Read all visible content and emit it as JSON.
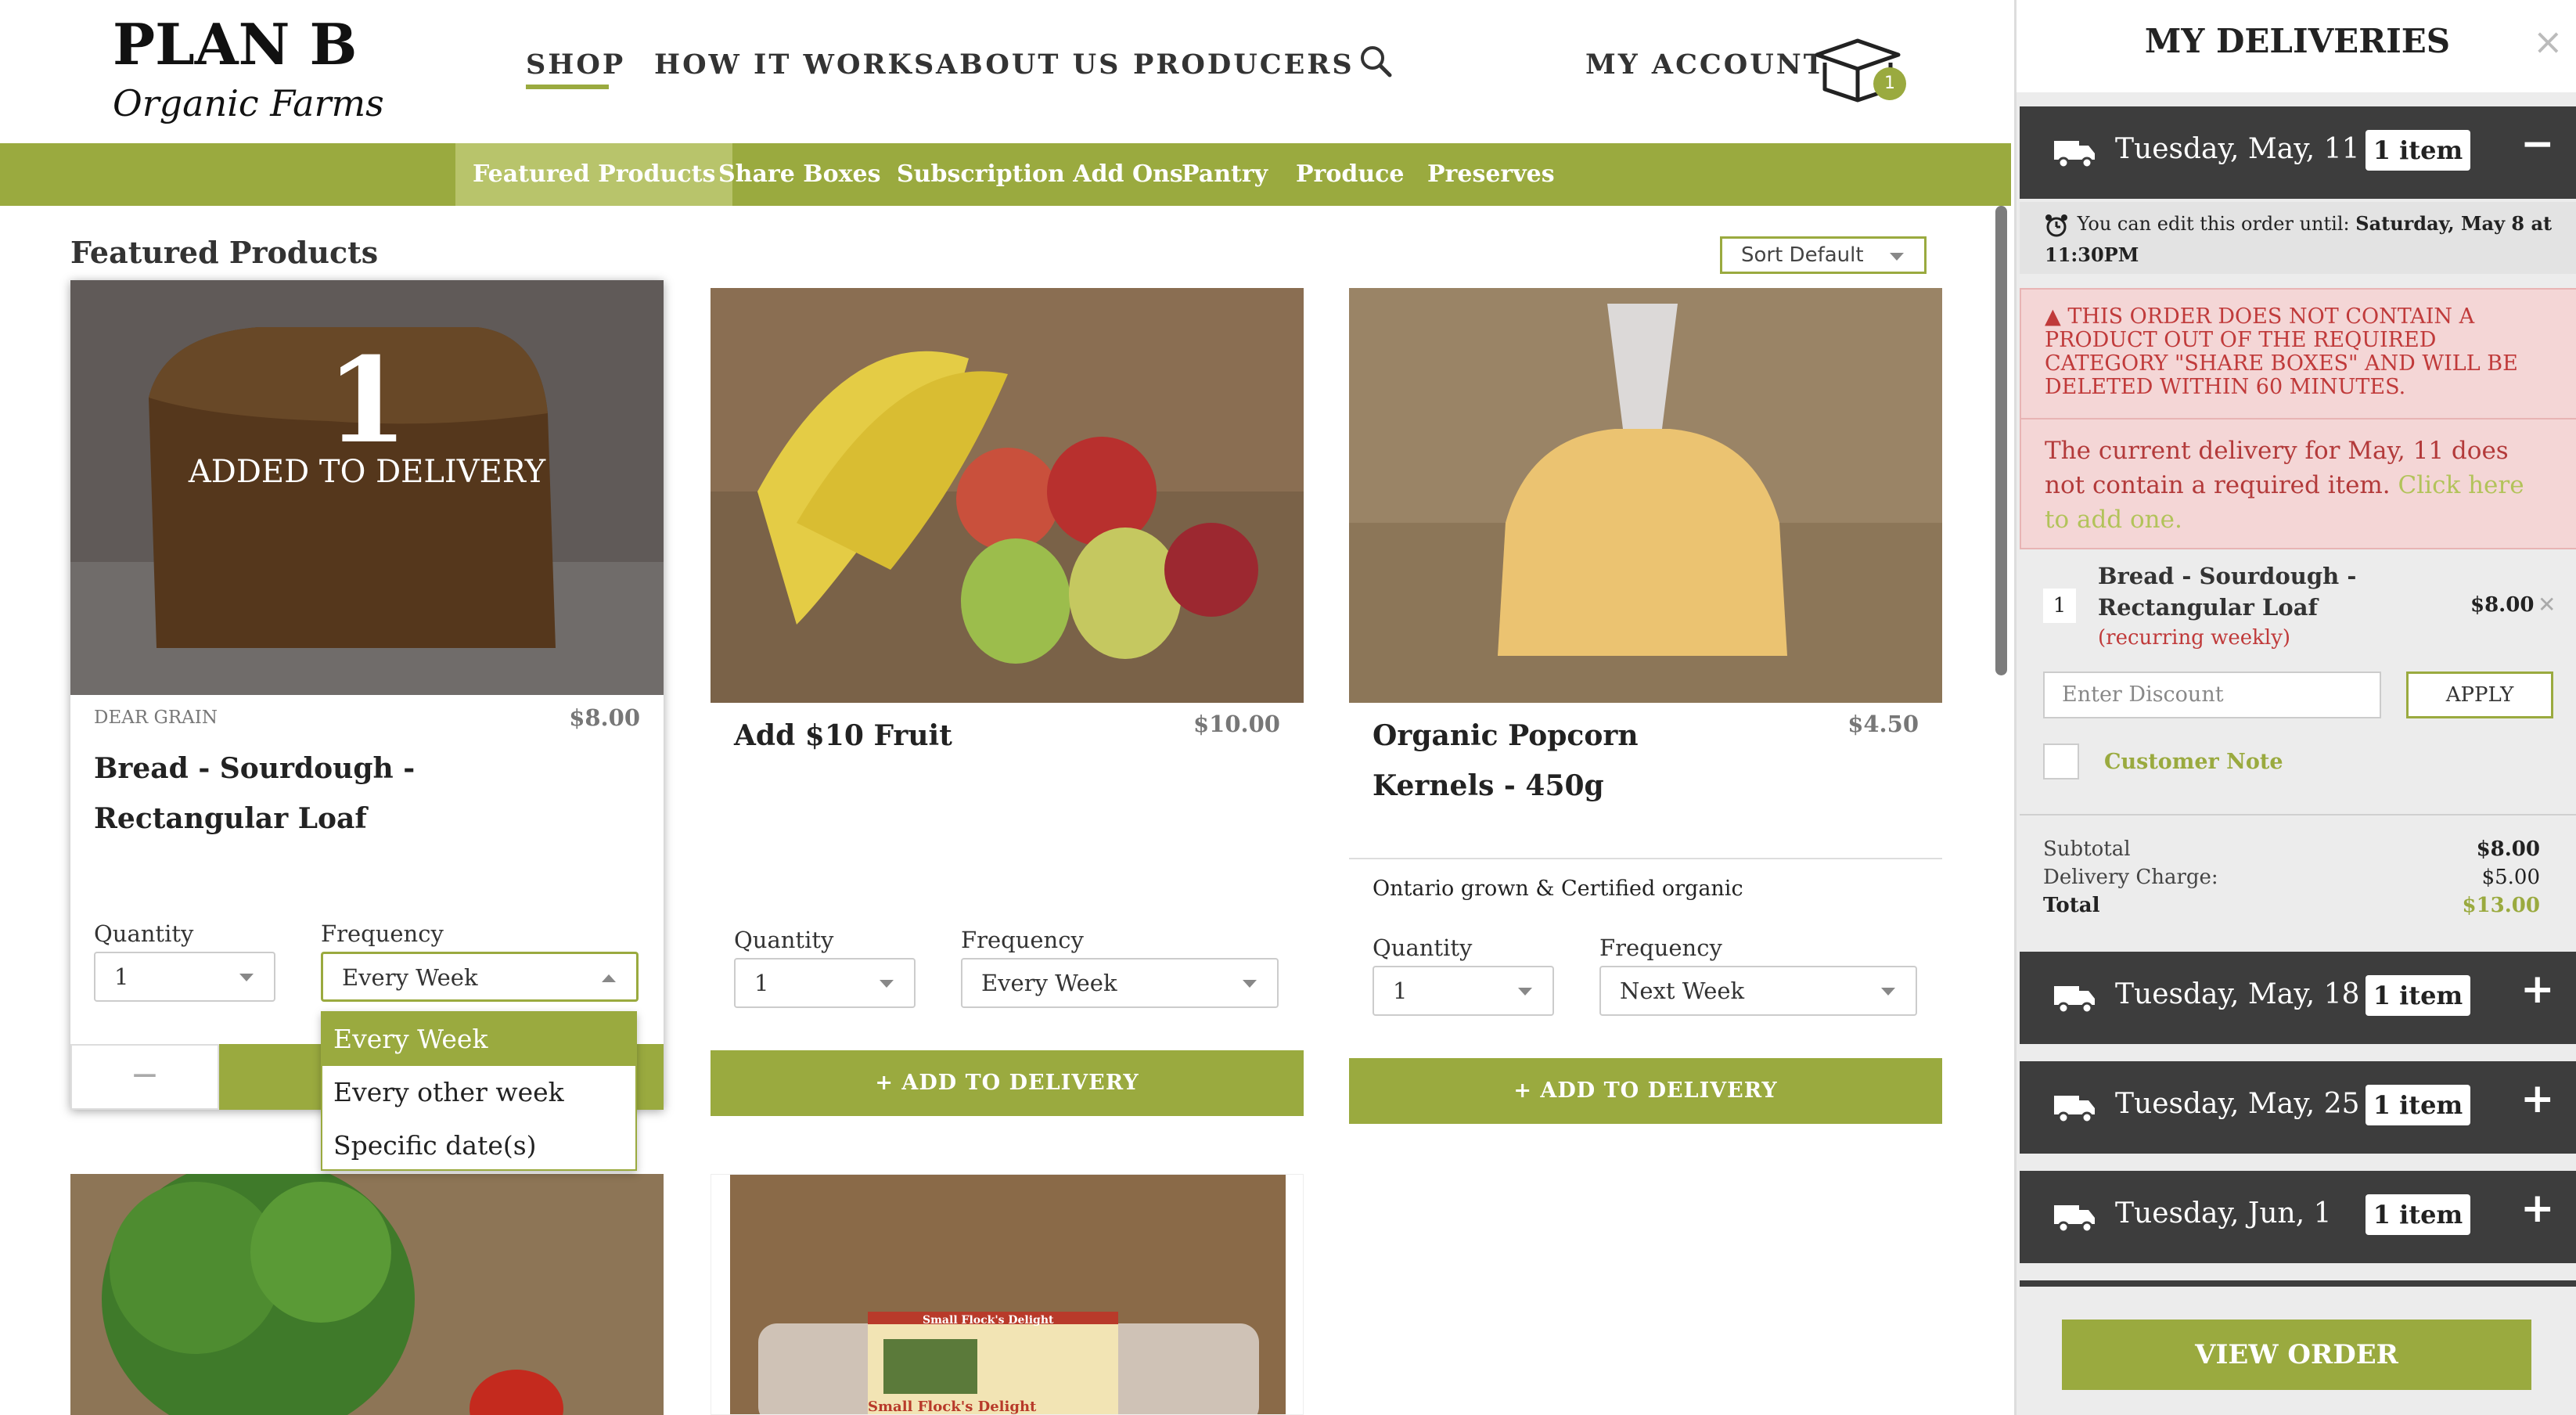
{
  "brand": {
    "logo_text": "PLAN B",
    "logo_sub": "Organic Farms"
  },
  "nav": {
    "shop": "SHOP",
    "how": "HOW IT WORKS",
    "about": "ABOUT US",
    "producers": "PRODUCERS",
    "account": "MY ACCOUNT",
    "cart_count": "1"
  },
  "categories": [
    "Featured Products",
    "Share Boxes",
    "Subscription Add Ons",
    "Pantry",
    "Produce",
    "Preserves"
  ],
  "section_title": "Featured Products",
  "sort_label": "Sort Default",
  "products": [
    {
      "overlay_count": "1",
      "overlay_text": "ADDED TO DELIVERY",
      "producer": "DEAR GRAIN",
      "price": "$8.00",
      "name": "Bread - Sourdough - Rectangular Loaf",
      "qty_label": "Quantity",
      "qty": "1",
      "freq_label": "Frequency",
      "freq": "Every Week",
      "minus": "−"
    },
    {
      "price": "$10.00",
      "name": "Add $10 Fruit",
      "qty_label": "Quantity",
      "qty": "1",
      "freq_label": "Frequency",
      "freq": "Every Week",
      "button": "+ ADD TO DELIVERY"
    },
    {
      "price": "$4.50",
      "name": "Organic Popcorn Kernels - 450g",
      "description": "Ontario grown & Certified organic",
      "qty_label": "Quantity",
      "qty": "1",
      "freq_label": "Frequency",
      "freq": "Next Week",
      "button": "+ ADD TO DELIVERY"
    }
  ],
  "egg_label": {
    "title": "Small Flock's Delight",
    "footer": "Small Flock's Delight"
  },
  "frequency_options": [
    "Every Week",
    "Every other week",
    "Specific date(s)"
  ],
  "sidebar": {
    "title": "MY DELIVERIES",
    "close": "×",
    "deliveries": [
      {
        "date": "Tuesday, May, 11",
        "items": "1 item",
        "toggle": "−"
      },
      {
        "date": "Tuesday, May, 18",
        "items": "1 item",
        "toggle": "+"
      },
      {
        "date": "Tuesday, May, 25",
        "items": "1 item",
        "toggle": "+"
      },
      {
        "date": "Tuesday, Jun, 1",
        "items": "1 item",
        "toggle": "+"
      }
    ],
    "edit_prefix": "You can edit this order until: ",
    "edit_until": "Saturday, May 8 at 11:30PM",
    "warning": "THIS ORDER DOES NOT CONTAIN A PRODUCT OUT OF THE REQUIRED CATEGORY \"SHARE BOXES\" AND WILL BE DELETED WITHIN 60 MINUTES.",
    "required_msg": "The current delivery for May, 11 does not contain a required item.",
    "required_link": "Click here to add one.",
    "item": {
      "qty": "1",
      "name_line1": "Bread - Sourdough -",
      "name_line2": "Rectangular Loaf",
      "recurring": "(recurring weekly)",
      "price": "$8.00"
    },
    "discount_placeholder": "Enter Discount",
    "apply": "APPLY",
    "customer_note": "Customer Note",
    "subtotal_label": "Subtotal",
    "subtotal": "$8.00",
    "delivery_label": "Delivery Charge:",
    "delivery": "$5.00",
    "total_label": "Total",
    "total": "$13.00",
    "view_order": "VIEW ORDER"
  },
  "colors": {
    "accent": "#9aaa3f",
    "dark": "#3d3d3d",
    "warning": "#c03a3a"
  }
}
